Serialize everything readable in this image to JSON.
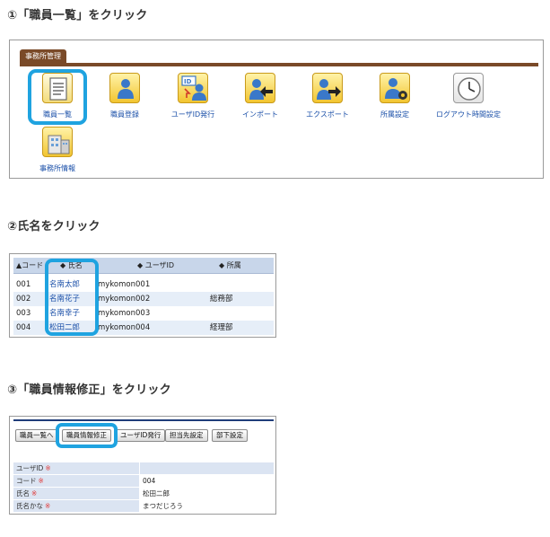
{
  "steps": [
    {
      "heading": "①「職員一覧」をクリック"
    },
    {
      "heading": "②氏名をクリック"
    },
    {
      "heading": "③「職員情報修正」をクリック"
    }
  ],
  "office_menu": {
    "tab_label": "事務所管理",
    "items": [
      {
        "label": "職員一覧",
        "icon": "staff-list-icon"
      },
      {
        "label": "職員登録",
        "icon": "staff-register-icon"
      },
      {
        "label": "ユーザID発行",
        "icon": "user-id-issue-icon"
      },
      {
        "label": "インポート",
        "icon": "import-icon"
      },
      {
        "label": "エクスポート",
        "icon": "export-icon"
      },
      {
        "label": "所属設定",
        "icon": "department-settings-icon"
      },
      {
        "label": "ログアウト時間設定",
        "icon": "clock-icon"
      },
      {
        "label": "事務所情報",
        "icon": "office-building-icon"
      }
    ],
    "highlight_color": "#1fa3e0",
    "bar_color": "#7a4a28"
  },
  "staff_table": {
    "columns": [
      {
        "sort_icon": "▲",
        "label": "コード"
      },
      {
        "sort_icon": "◆",
        "label": "氏名"
      },
      {
        "sort_icon": "◆",
        "label": "ユーザID"
      },
      {
        "sort_icon": "◆",
        "label": "所属"
      }
    ],
    "rows": [
      {
        "code": "001",
        "name": "名南太郎",
        "user_id": "mykomon001",
        "dept": ""
      },
      {
        "code": "002",
        "name": "名南花子",
        "user_id": "mykomon002",
        "dept": "総務部"
      },
      {
        "code": "003",
        "name": "名南幸子",
        "user_id": "mykomon003",
        "dept": ""
      },
      {
        "code": "004",
        "name": "松田二郎",
        "user_id": "mykomon004",
        "dept": "経理部"
      }
    ]
  },
  "staff_detail": {
    "buttons": [
      "職員一覧へ",
      "職員情報修正",
      "ユーザID発行",
      "担当先設定",
      "部下設定"
    ],
    "required_mark": "※",
    "fields": [
      {
        "label": "ユーザID",
        "value": ""
      },
      {
        "label": "コード",
        "value": "004"
      },
      {
        "label": "氏名",
        "value": "松田二郎"
      },
      {
        "label": "氏名かな",
        "value": "まつだじろう"
      }
    ]
  }
}
